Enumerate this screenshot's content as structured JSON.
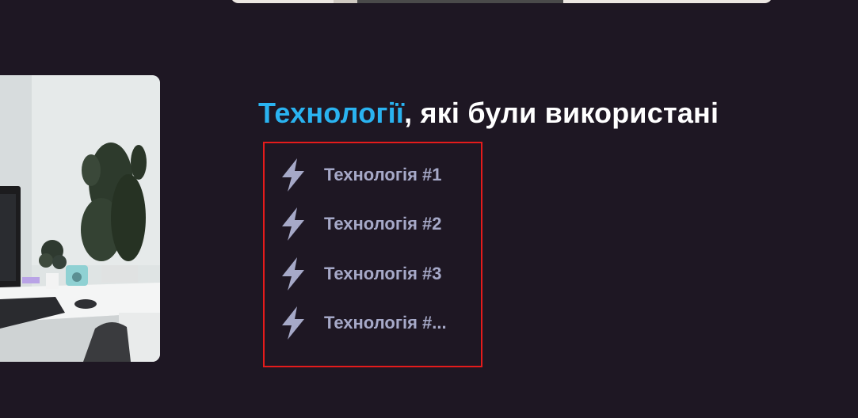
{
  "colors": {
    "background": "#1e1723",
    "accent": "#2ab3f0",
    "title_text": "#ffffff",
    "item_text": "#a6a9c8",
    "icon": "#a6a9c8",
    "highlight_border": "#e41b1b"
  },
  "section": {
    "title_accent": "Технології",
    "title_rest": ", які були використані"
  },
  "tech_list": {
    "icon_name": "lightning-bolt-icon",
    "items": [
      {
        "label": "Технологія #1"
      },
      {
        "label": "Технологія #2"
      },
      {
        "label": "Технологія #3"
      },
      {
        "label": "Технологія #..."
      }
    ]
  }
}
